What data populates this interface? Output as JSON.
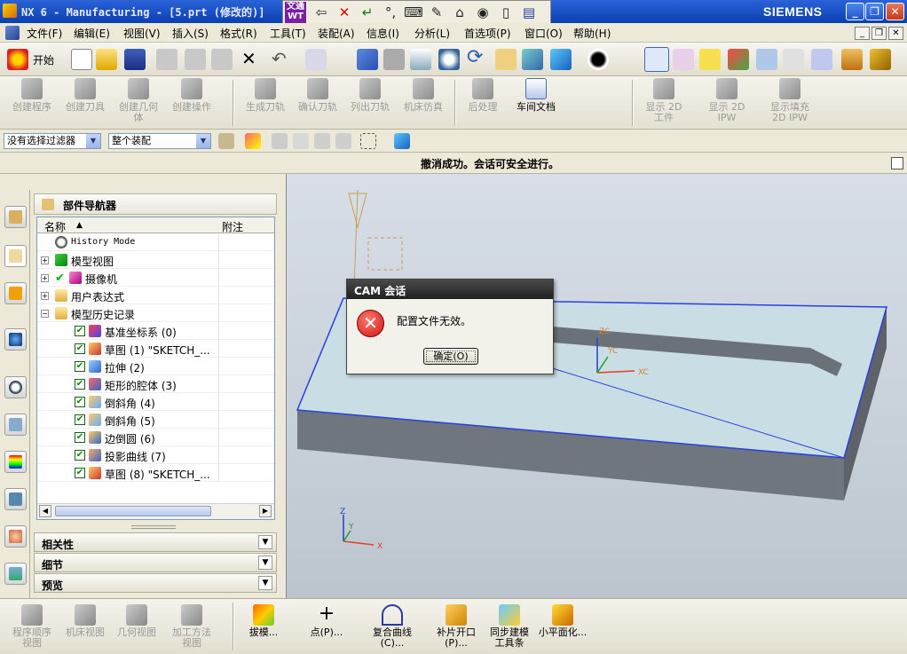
{
  "window": {
    "title": "NX 6 - Manufacturing - [5.prt (修改的)]",
    "brand": "SIEMENS"
  },
  "ime": {
    "logo": "文通WT"
  },
  "menu": [
    "文件(F)",
    "编辑(E)",
    "视图(V)",
    "插入(S)",
    "格式(R)",
    "工具(T)",
    "装配(A)",
    "信息(I)",
    "分析(L)",
    "首选项(P)",
    "窗口(O)",
    "帮助(H)"
  ],
  "toolbar": {
    "start_label": "开始"
  },
  "operations": {
    "create_program": "创建程序",
    "create_tool": "创建刀具",
    "create_geometry": "创建几何\n体",
    "create_operation": "创建操作",
    "generate_path": "生成刀轨",
    "verify_path": "确认刀轨",
    "list_path": "列出刀轨",
    "machine_sim": "机床仿真",
    "postprocess": "后处理",
    "shop_docs": "车间文档",
    "show_2d_workpiece": "显示 2D\n工件",
    "show_2d_ipw": "显示 2D\nIPW",
    "show_fill_2d_ipw": "显示填充\n2D IPW"
  },
  "filters": {
    "selection_filter": "没有选择过滤器",
    "assembly_scope": "整个装配"
  },
  "cue": {
    "message": "撤消成功。会话可安全进行。"
  },
  "navigator": {
    "title": "部件导航器",
    "columns": {
      "name": "名称",
      "note": "附注"
    },
    "items": [
      {
        "label": "History Mode"
      },
      {
        "label": "模型视图"
      },
      {
        "label": "摄像机"
      },
      {
        "label": "用户表达式"
      },
      {
        "label": "模型历史记录"
      },
      {
        "label": "基准坐标系 (0)"
      },
      {
        "label": "草图 (1) \"SKETCH_..."
      },
      {
        "label": "拉伸 (2)"
      },
      {
        "label": "矩形的腔体 (3)"
      },
      {
        "label": "倒斜角 (4)"
      },
      {
        "label": "倒斜角 (5)"
      },
      {
        "label": "边倒圆 (6)"
      },
      {
        "label": "投影曲线 (7)"
      },
      {
        "label": "草图 (8) \"SKETCH_..."
      }
    ],
    "panels": [
      "相关性",
      "细节",
      "预览"
    ]
  },
  "viewport": {
    "axes": {
      "zc": "ZC",
      "yc": "YC",
      "xc": "XC",
      "z": "Z",
      "y": "Y",
      "x": "X"
    }
  },
  "dialog": {
    "title": "CAM 会话",
    "message": "配置文件无效。",
    "ok": "确定(O)"
  },
  "bottom": {
    "program_order_view": "程序顺序\n视图",
    "machine_view": "机床视图",
    "geometry_view": "几何视图",
    "method_view": "加工方法\n视图",
    "draft": "拔模...",
    "point": "点(P)...",
    "composite_curve": "复合曲线\n(C)...",
    "patch_opening": "补片开口\n(P)...",
    "sync_modeling": "同步建模\n工具条",
    "small_face": "小平面化..."
  }
}
